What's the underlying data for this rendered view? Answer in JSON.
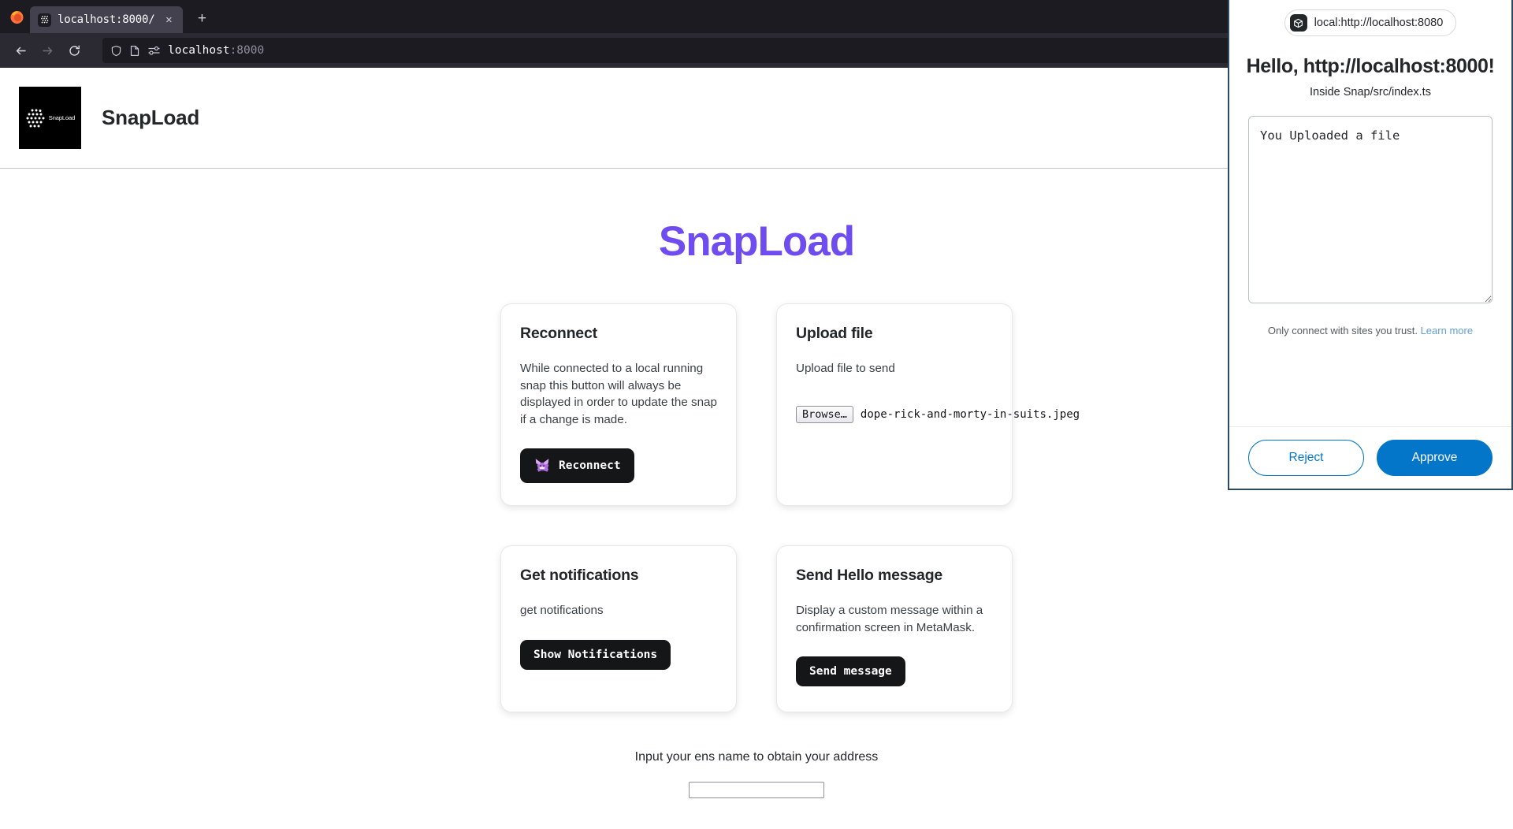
{
  "browser": {
    "tab": {
      "title": "localhost:8000/",
      "favicon_name": "snapload-favicon",
      "close_label": "×"
    },
    "new_tab_label": "+",
    "nav": {
      "back_label": "←",
      "forward_label": "→",
      "reload_label": "⟳"
    },
    "urlbar": {
      "host": "localhost",
      "port": ":8000",
      "shield_icon": "shield-icon",
      "page_icon": "page-icon",
      "permissions_icon": "permissions-icon"
    }
  },
  "site": {
    "logo_word": "SnapLoad",
    "name": "SnapLoad",
    "main_title": "SnapLoad"
  },
  "cards": [
    {
      "id": "reconnect",
      "title": "Reconnect",
      "desc": "While connected to a local running snap this button will always be displayed in order to update the snap if a change is made.",
      "button_label": "Reconnect",
      "button_icon": "metamask-fox-icon"
    },
    {
      "id": "upload-file",
      "title": "Upload file",
      "desc": "Upload file to send",
      "browse_label": "Browse…",
      "file_name": "dope-rick-and-morty-in-suits.jpeg"
    },
    {
      "id": "get-notifications",
      "title": "Get notifications",
      "desc": "get notifications",
      "button_label": "Show Notifications"
    },
    {
      "id": "send-hello-message",
      "title": "Send Hello message",
      "desc": "Display a custom message within a confirmation screen in MetaMask.",
      "button_label": "Send message"
    }
  ],
  "ens": {
    "label": "Input your ens name to obtain your address",
    "value": "",
    "placeholder": ""
  },
  "metamask": {
    "origin_text": "local:http://localhost:8080",
    "origin_icon": "cube-icon",
    "heading": "Hello, http://localhost:8000!",
    "subheading": "Inside Snap/src/index.ts",
    "textarea_value": "You Uploaded a file",
    "trust_text": "Only connect with sites you trust.",
    "learn_more": "Learn more",
    "reject_label": "Reject",
    "approve_label": "Approve"
  },
  "colors": {
    "brand_purple": "#6f4cf0",
    "metamask_blue": "#0376c9",
    "dark_button": "#141618",
    "popup_border": "#2c4960"
  }
}
